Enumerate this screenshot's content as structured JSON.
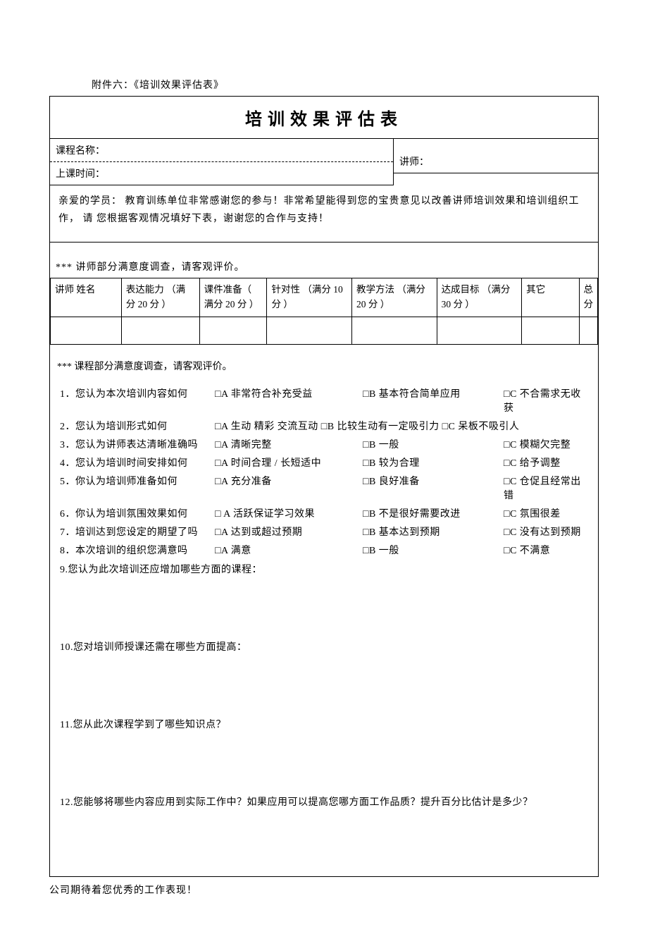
{
  "attachment": "附件六：《培训效果评估表》",
  "title": "培训效果评估表",
  "course_name_label": "课程名称：",
  "class_time_label": "上课时间：",
  "lecturer_label": "讲师：",
  "greeting": "亲爱的学员： 教育训练单位非常感谢您的参与！非常希望能得到您的宝贵意见以改善讲师培训效果和培训组织工作， 请 您根据客观情况填好下表，谢谢您的合作与支持！",
  "lecturer_section_head": "*** 讲师部分满意度调查，请客观评价。",
  "score_headers": {
    "c1": "讲师 姓名",
    "c2": "表达能力 （满分 20 分 ）",
    "c3": "课件准备（ 满分 20 分 ）",
    "c4": "针对性 （满分 10 分 ）",
    "c5": "教学方法 （满分 20 分 ）",
    "c6": "达成目标 （满分 30 分 ）",
    "c7": "其它",
    "c8": "总分"
  },
  "course_section_head": "*** 课程部分满意度调查，请客观评价。",
  "questions": [
    {
      "q": "1．您认为本次培训内容如何",
      "a": "□A 非常符合补充受益",
      "b": "□B 基本符合简单应用",
      "c": "□C 不合需求无收获"
    },
    {
      "q": "2．您认为培训形式如何",
      "a": "□A 生动 精彩 交流互动",
      "b": "□B 比较生动有一定吸引力",
      "c": "□C 呆板不吸引人"
    },
    {
      "q": "3．您认为讲师表达清晰准确吗",
      "a": "□A 清晰完整",
      "b": "□B 一般",
      "c": "□C 模糊欠完整"
    },
    {
      "q": "4．您认为培训时间安排如何",
      "a": "□A 时间合理 / 长短适中",
      "b": "□B 较为合理",
      "c": "□C 给予调整"
    },
    {
      "q": "5．你认为培训师准备如何",
      "a": "□A 充分准备",
      "b": "□B 良好准备",
      "c": "□C 仓促且经常出错"
    },
    {
      "q": "6．你认为培训氛围效果如何",
      "a": "□ A 活跃保证学习效果",
      "b": "□B 不是很好需要改进",
      "c": "□C 氛围很差"
    },
    {
      "q": "7．培训达到您设定的期望了吗",
      "a": "□A 达到或超过预期",
      "b": "□B 基本达到预期",
      "c": "□C 没有达到预期"
    },
    {
      "q": "8．本次培训的组织您满意吗",
      "a": "□A 满意",
      "b": "□B 一般",
      "c": "□C 不满意"
    }
  ],
  "q9": "9.您认为此次培训还应增加哪些方面的课程：",
  "q10": "10.您对培训师授课还需在哪些方面提高：",
  "q11": "11.您从此次课程学到了哪些知识点？",
  "q12": "12.您能够将哪些内容应用到实际工作中？如果应用可以提高您哪方面工作品质？提升百分比估计是多少？",
  "footer": "公司期待着您优秀的工作表现！"
}
